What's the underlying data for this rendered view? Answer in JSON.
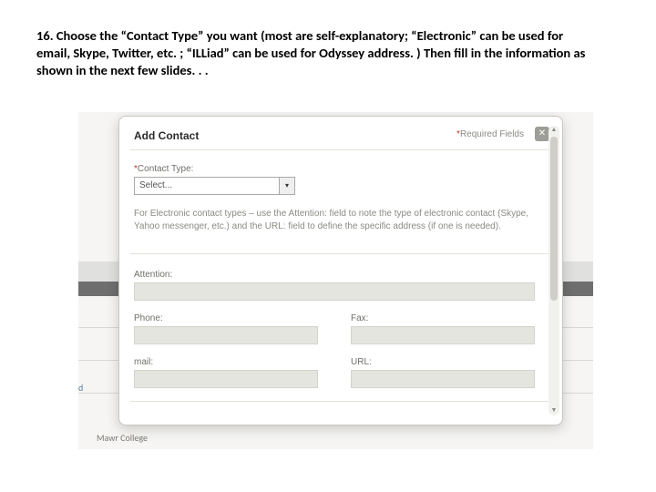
{
  "caption": "16. Choose the “Contact Type” you want (most are self-explanatory; “Electronic” can be used for email, Skype, Twitter, etc. ; “ILLiad” can be used for Odyssey address. )  Then fill in the information as shown in the next few slides. . .",
  "background": {
    "left_tag": "d",
    "footer_text": "Mawr College"
  },
  "modal": {
    "title": "Add Contact",
    "required_label": "Required Fields",
    "required_star": "*",
    "close_glyph": "✕",
    "contact_type": {
      "label": "Contact Type:",
      "star": "*",
      "selected": "Select..."
    },
    "hint": "For Electronic contact types – use the Attention: field to note the type of electronic contact (Skype, Yahoo messenger, etc.) and the URL: field to define the specific address (if one is needed).",
    "fields": {
      "attention": "Attention:",
      "phone": "Phone:",
      "fax": "Fax:",
      "mail": "mail:",
      "url": "URL:"
    },
    "scroll": {
      "up": "▲",
      "down": "▼"
    }
  }
}
